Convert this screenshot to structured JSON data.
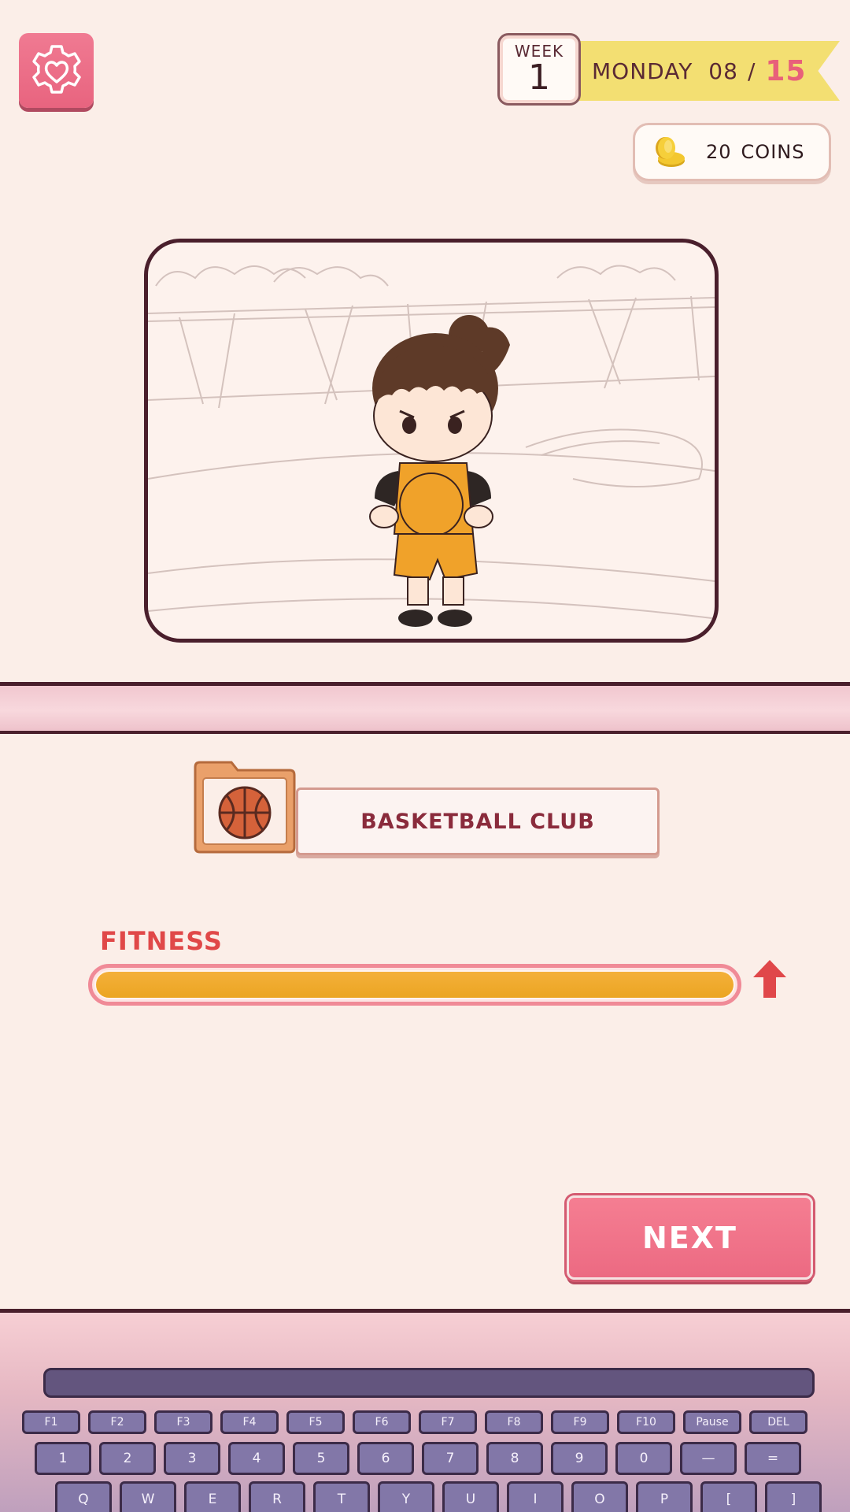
{
  "header": {
    "week_label": "WEEK",
    "week_number": "1",
    "day": "MONDAY",
    "day_current": "08",
    "separator": "/",
    "day_total": "15",
    "coins_value": "20",
    "coins_label": "COINS"
  },
  "activity": {
    "name": "BASKETBALL CLUB",
    "icon": "basketball-icon"
  },
  "stat": {
    "label": "FITNESS",
    "value_fraction": 1.0,
    "trend": "up"
  },
  "next_button": {
    "label": "NEXT"
  },
  "keyboard": {
    "function_row": [
      "F1",
      "F2",
      "F3",
      "F4",
      "F5",
      "F6",
      "F7",
      "F8",
      "F9",
      "F10",
      "Pause",
      "DEL"
    ],
    "number_row": [
      "1",
      "2",
      "3",
      "4",
      "5",
      "6",
      "7",
      "8",
      "9",
      "0",
      "—",
      "="
    ],
    "qwerty_row": [
      "Q",
      "W",
      "E",
      "R",
      "T",
      "Y",
      "U",
      "I",
      "O",
      "P",
      "[",
      "]"
    ]
  },
  "colors": {
    "background": "#fbeee8",
    "accent_pink": "#ec6a82",
    "ribbon_yellow": "#f3df72",
    "stat_fill": "#eba522",
    "stat_label": "#e04848"
  }
}
